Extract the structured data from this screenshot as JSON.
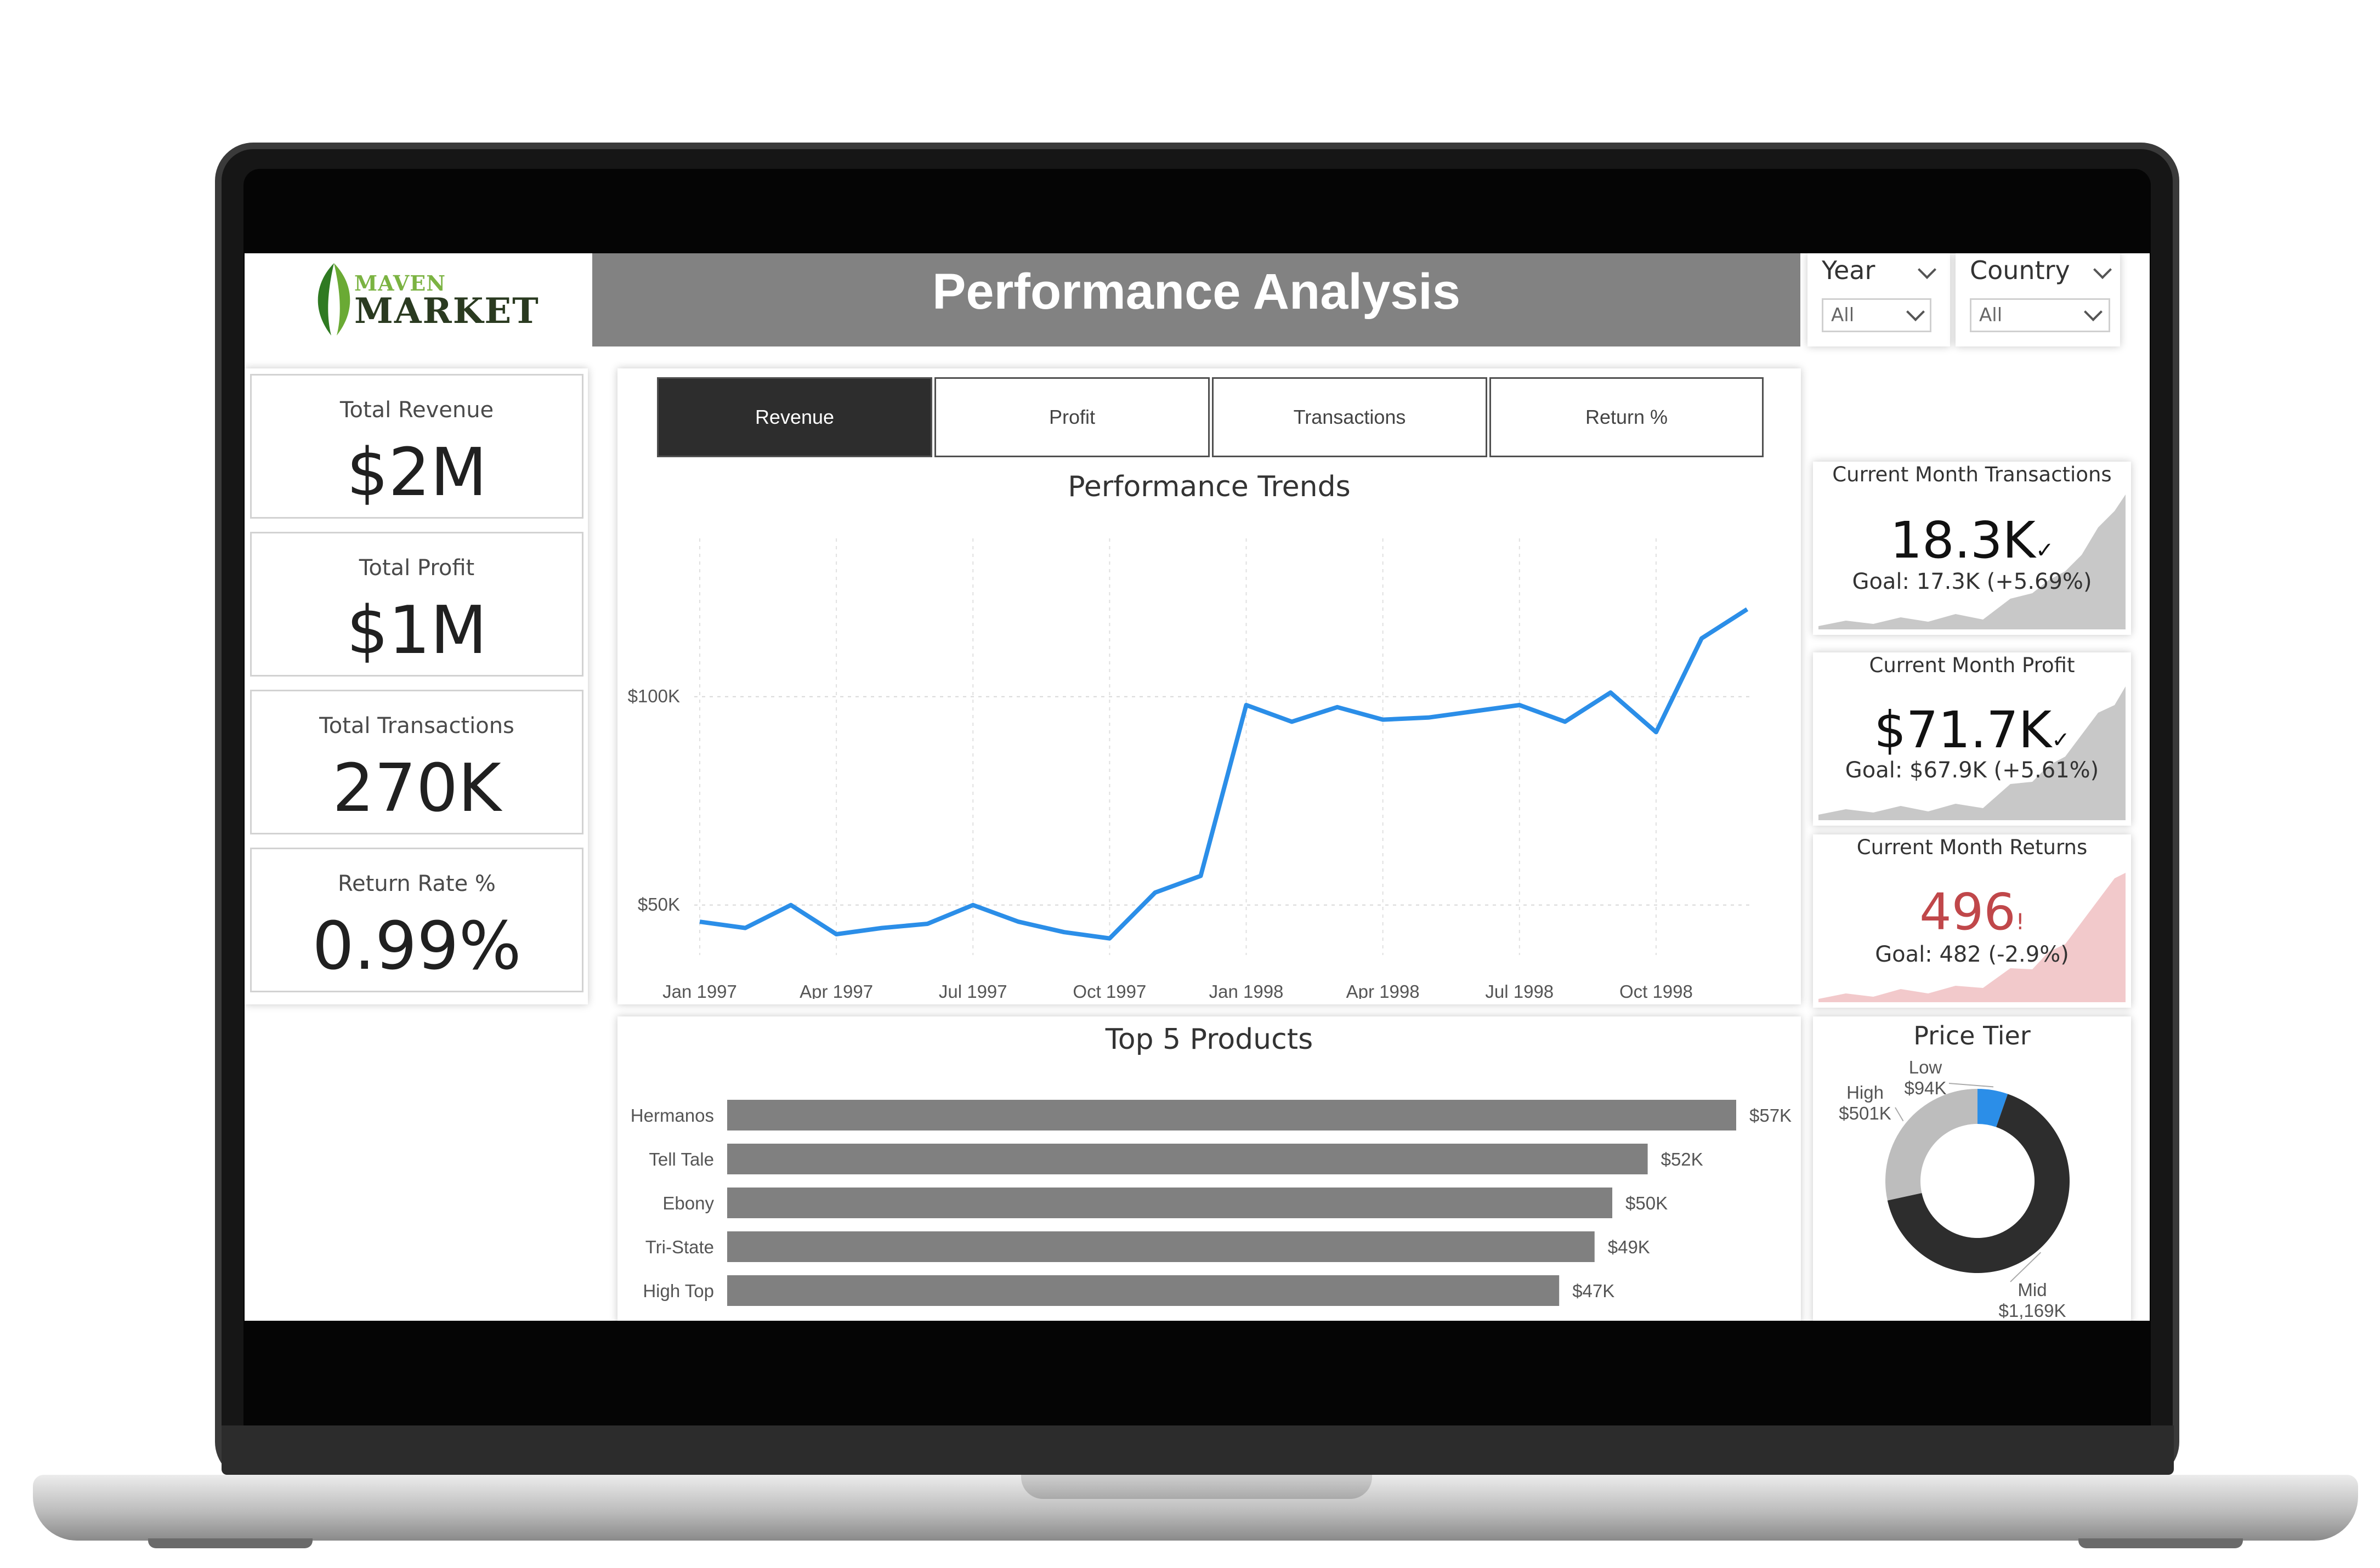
{
  "brand": {
    "word1": "MAVEN",
    "word2": "MARKET"
  },
  "header": {
    "title": "Performance Analysis"
  },
  "filters": {
    "year": {
      "label": "Year",
      "value": "All"
    },
    "country": {
      "label": "Country",
      "value": "All"
    }
  },
  "kpis": [
    {
      "label": "Total Revenue",
      "value": "$2M"
    },
    {
      "label": "Total Profit",
      "value": "$1M"
    },
    {
      "label": "Total Transactions",
      "value": "270K"
    },
    {
      "label": "Return Rate %",
      "value": "0.99%"
    }
  ],
  "tabs": [
    {
      "label": "Revenue",
      "active": true
    },
    {
      "label": "Profit",
      "active": false
    },
    {
      "label": "Transactions",
      "active": false
    },
    {
      "label": "Return %",
      "active": false
    }
  ],
  "cards": {
    "transactions": {
      "title": "Current Month Transactions",
      "value": "18.3K",
      "status": "✓",
      "goal": "Goal: 17.3K (+5.69%)"
    },
    "profit": {
      "title": "Current Month Profit",
      "value": "$71.7K",
      "status": "✓",
      "goal": "Goal: $67.9K (+5.61%)"
    },
    "returns": {
      "title": "Current Month Returns",
      "value": "496",
      "status": "!",
      "goal": "Goal: 482 (-2.9%)"
    }
  },
  "colors": {
    "line": "#2b8ee8",
    "bar": "#808080",
    "header": "#828282",
    "returns_value": "#c0474a",
    "leaf": "#3e8a2e"
  },
  "chart_data": [
    {
      "type": "line",
      "title": "Performance Trends",
      "x": [
        "Jan 1997",
        "Feb 1997",
        "Mar 1997",
        "Apr 1997",
        "May 1997",
        "Jun 1997",
        "Jul 1997",
        "Aug 1997",
        "Sep 1997",
        "Oct 1997",
        "Nov 1997",
        "Dec 1997",
        "Jan 1998",
        "Feb 1998",
        "Mar 1998",
        "Apr 1998",
        "May 1998",
        "Jun 1998",
        "Jul 1998",
        "Aug 1998",
        "Sep 1998",
        "Oct 1998",
        "Nov 1998",
        "Dec 1998"
      ],
      "x_tick_labels": [
        "Jan 1997",
        "Apr 1997",
        "Jul 1997",
        "Oct 1997",
        "Jan 1998",
        "Apr 1998",
        "Jul 1998",
        "Oct 1998"
      ],
      "y_tick_labels": [
        "$50K",
        "$100K"
      ],
      "y_ticks": [
        50000,
        100000
      ],
      "ylim": [
        38000,
        138000
      ],
      "series": [
        {
          "values": [
            46000,
            44500,
            50000,
            43000,
            44500,
            45500,
            50000,
            46000,
            43500,
            42000,
            53000,
            57000,
            98000,
            94000,
            97500,
            94500,
            95000,
            96500,
            98000,
            94000,
            101000,
            91500,
            114000,
            121000
          ]
        }
      ],
      "grid": true
    },
    {
      "type": "bar",
      "orientation": "horizontal",
      "title": "Top 5 Products",
      "categories": [
        "Hermanos",
        "Tell Tale",
        "Ebony",
        "Tri-State",
        "High Top"
      ],
      "values": [
        57000,
        52000,
        50000,
        49000,
        47000
      ],
      "labels": [
        "$57K",
        "$52K",
        "$50K",
        "$49K",
        "$47K"
      ],
      "xlim": [
        0,
        57000
      ]
    },
    {
      "type": "pie",
      "donut": true,
      "title": "Price Tier",
      "slices": [
        {
          "name": "Low",
          "value": 94000,
          "label": "$94K",
          "color": "#2b8ee8"
        },
        {
          "name": "Mid",
          "value": 1169000,
          "label": "$1,169K",
          "color": "#2d2d2d"
        },
        {
          "name": "High",
          "value": 501000,
          "label": "$501K",
          "color": "#bdbdbd"
        }
      ]
    }
  ]
}
